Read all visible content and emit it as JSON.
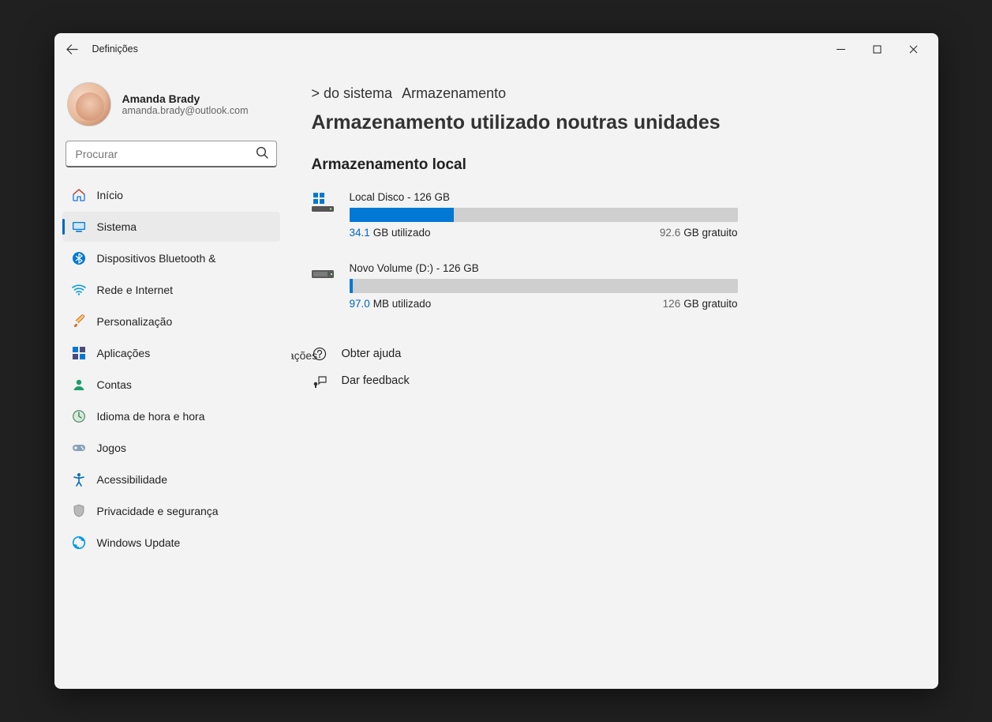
{
  "window": {
    "title": "Definições"
  },
  "profile": {
    "name": "Amanda Brady",
    "email": "amanda.brady@outlook.com"
  },
  "search": {
    "placeholder": "Procurar"
  },
  "nav": {
    "items": [
      {
        "id": "inicio",
        "label": "Início",
        "active": false
      },
      {
        "id": "sistema",
        "label": "Sistema",
        "active": true
      },
      {
        "id": "bluetooth",
        "label": "Dispositivos Bluetooth &amp;",
        "active": false
      },
      {
        "id": "rede",
        "label": "Rede e Internet",
        "active": false
      },
      {
        "id": "personalizacao",
        "label": "Personalização",
        "active": false
      },
      {
        "id": "aplicacoes",
        "label": "Aplicações",
        "active": false
      },
      {
        "id": "contas",
        "label": "Contas",
        "active": false
      },
      {
        "id": "idioma",
        "label": "Idioma de hora e hora",
        "active": false
      },
      {
        "id": "jogos",
        "label": "Jogos",
        "active": false
      },
      {
        "id": "acessibilidade",
        "label": "Acessibilidade",
        "active": false
      },
      {
        "id": "privacidade",
        "label": "Privacidade e segurança",
        "active": false
      },
      {
        "id": "update",
        "label": "Windows Update",
        "active": false
      }
    ]
  },
  "breadcrumb": {
    "part1": "&gt; do sistema",
    "part2": "Armazenamento",
    "title": "Armazenamento utilizado noutras unidades"
  },
  "section": {
    "heading": "Armazenamento local"
  },
  "drives": [
    {
      "name": "Local  Disco - 126 GB",
      "used_num": "34.1",
      "used_label": "GB utilizado",
      "free_num": "92.6",
      "free_label": "GB gratuito",
      "pct": 27
    },
    {
      "name": "Novo Volume (D:) - 126 GB",
      "used_num": "97.0",
      "used_label": "MB utilizado",
      "free_num": "126",
      "free_label": "GB gratuito",
      "pct": 1
    }
  ],
  "side_floating_label": "Aplicações",
  "links": {
    "help": "Obter ajuda",
    "feedback": "Dar feedback"
  }
}
